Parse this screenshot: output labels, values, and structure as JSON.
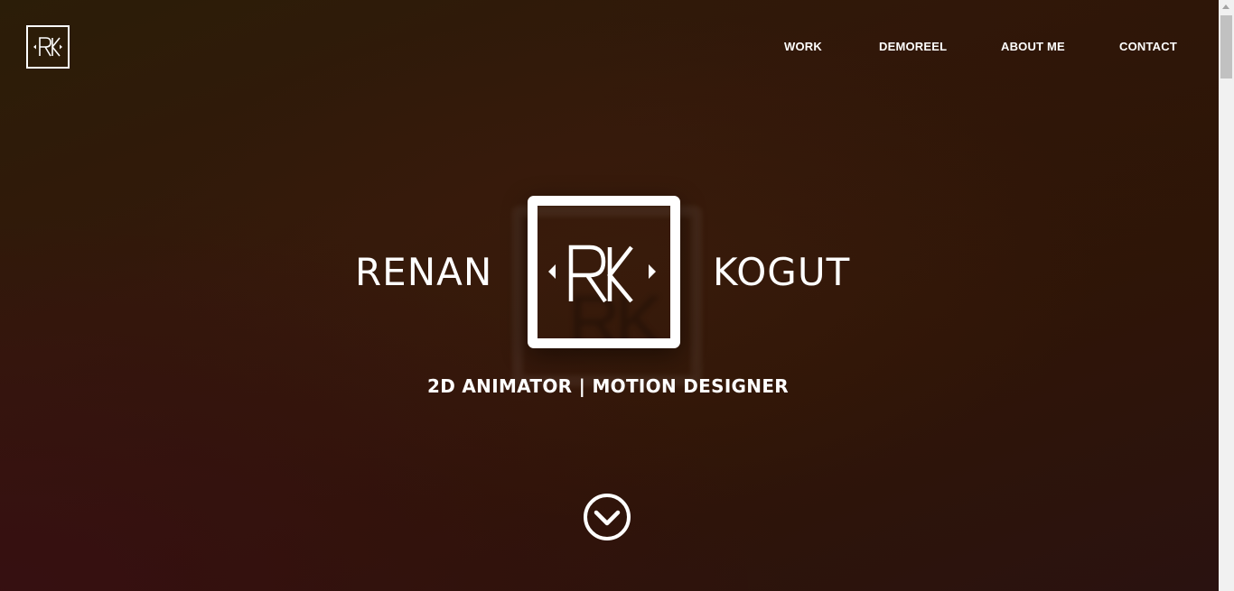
{
  "header": {
    "logo_icon": "rk-monogram-logo-icon"
  },
  "nav": {
    "items": [
      {
        "label": "WORK"
      },
      {
        "label": "DEMOREEL"
      },
      {
        "label": "ABOUT ME"
      },
      {
        "label": "CONTACT"
      }
    ]
  },
  "hero": {
    "first_name": "RENAN",
    "last_name": "KOGUT",
    "logo_icon": "rk-monogram-logo-icon",
    "tagline": "2D ANIMATOR | MOTION DESIGNER",
    "scroll_icon": "chevron-down-circle-icon"
  },
  "colors": {
    "background": "#2f1708",
    "text": "#ffffff",
    "scrollbar_track": "#f1f1f1",
    "scrollbar_thumb": "#c1c1c1"
  }
}
